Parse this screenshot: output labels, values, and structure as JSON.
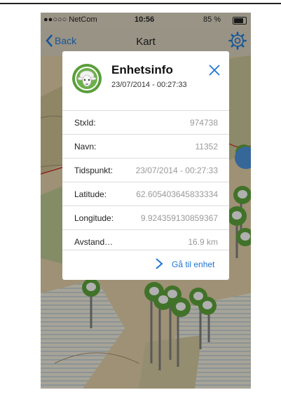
{
  "status_bar": {
    "carrier": "●●○○○ NetCom",
    "time": "10:56",
    "battery": "85 %"
  },
  "nav": {
    "back_label": "Back",
    "title": "Kart"
  },
  "dialog": {
    "title": "Enhetsinfo",
    "subtitle": "23/07/2014 - 00:27:33",
    "rows": [
      {
        "label": "StxId:",
        "value": "974738"
      },
      {
        "label": "Navn:",
        "value": "11352"
      },
      {
        "label": "Tidspunkt:",
        "value": "23/07/2014 - 00:27:33"
      },
      {
        "label": "Latitude:",
        "value": "62.605403645833334"
      },
      {
        "label": "Longitude:",
        "value": "9.924359130859367"
      },
      {
        "label": "Avstand…",
        "value": "16.9 km"
      }
    ],
    "action_label": "Gå til enhet"
  },
  "icons": {
    "back": "chevron-left-icon",
    "settings": "gear-icon",
    "close": "close-icon",
    "avatar": "sheep-icon",
    "action": "chevron-right-icon"
  },
  "colors": {
    "accent": "#1e76d2",
    "marker_green": "#5a9e3a"
  }
}
